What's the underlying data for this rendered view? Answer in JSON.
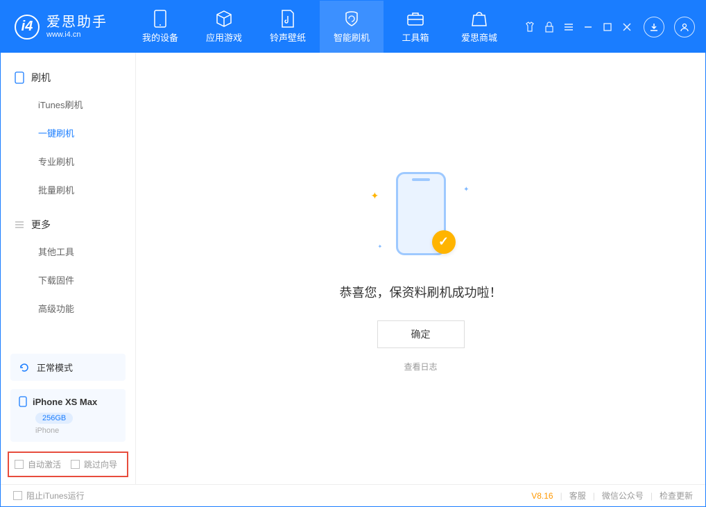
{
  "app": {
    "title": "爱思助手",
    "subtitle": "www.i4.cn"
  },
  "nav": {
    "items": [
      {
        "label": "我的设备"
      },
      {
        "label": "应用游戏"
      },
      {
        "label": "铃声壁纸"
      },
      {
        "label": "智能刷机"
      },
      {
        "label": "工具箱"
      },
      {
        "label": "爱思商城"
      }
    ]
  },
  "sidebar": {
    "section1": {
      "title": "刷机",
      "items": [
        "iTunes刷机",
        "一键刷机",
        "专业刷机",
        "批量刷机"
      ],
      "active_index": 1
    },
    "section2": {
      "title": "更多",
      "items": [
        "其他工具",
        "下载固件",
        "高级功能"
      ]
    },
    "status": "正常模式",
    "device": {
      "name": "iPhone XS Max",
      "capacity": "256GB",
      "type": "iPhone"
    },
    "checks": {
      "auto_activate": "自动激活",
      "skip_guide": "跳过向导"
    }
  },
  "main": {
    "success_text": "恭喜您，保资料刷机成功啦！",
    "ok_button": "确定",
    "view_log": "查看日志"
  },
  "footer": {
    "block_itunes": "阻止iTunes运行",
    "version": "V8.16",
    "links": [
      "客服",
      "微信公众号",
      "检查更新"
    ]
  }
}
